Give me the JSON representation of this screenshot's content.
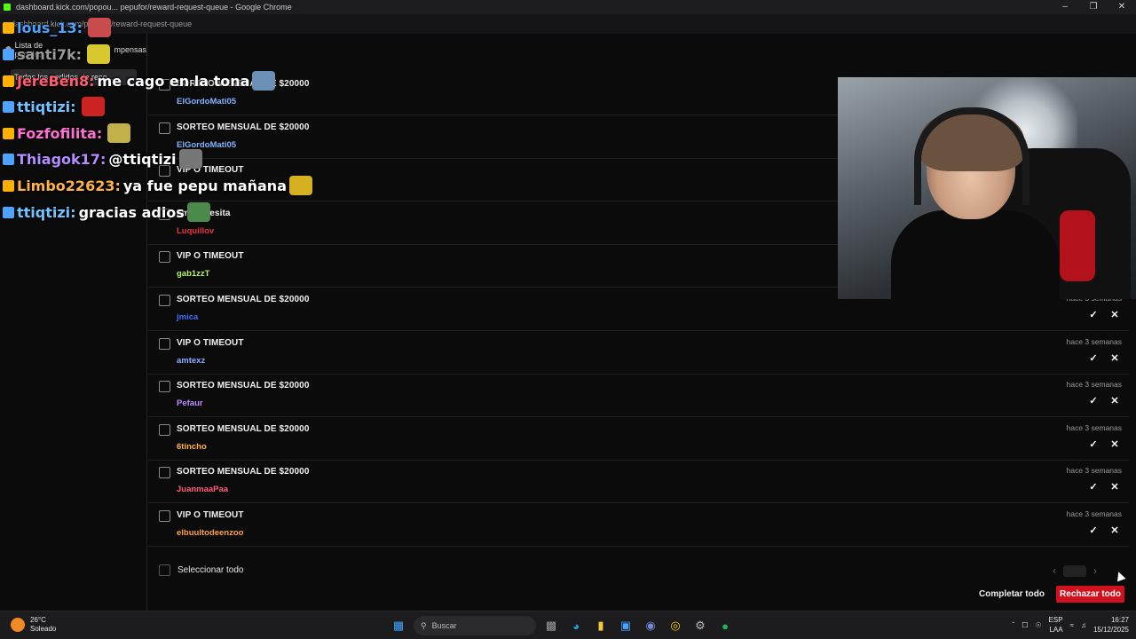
{
  "window": {
    "title": "dashboard.kick.com/popou... pepufor/reward-request-queue - Google Chrome",
    "url_text": "dashboard.kick.com/pepufor/reward-request-queue"
  },
  "sidebar": {
    "list_label": "Lista de pedidos",
    "list_suffix": "mpensas",
    "sub_label": "Todos los pedidos de reco..."
  },
  "chat": [
    {
      "user": "lous_13:",
      "user_color": "#4fa3ff",
      "msg": ""
    },
    {
      "user": "santi7k:",
      "user_color": "#9a9a9a",
      "msg": ""
    },
    {
      "user": "JereBen8:",
      "user_color": "#ff5a6e",
      "msg": "me cago en la tona"
    },
    {
      "user": "ttiqtizi:",
      "user_color": "#6fc3ff",
      "msg": ""
    },
    {
      "user": "Fozfofilita:",
      "user_color": "#ff6fd2",
      "msg": ""
    },
    {
      "user": "Thiagok17:",
      "user_color": "#b48cff",
      "msg": "@ttiqtizi"
    },
    {
      "user": "Limbo22623:",
      "user_color": "#ffb347",
      "msg": "ya fue pepu mañana"
    },
    {
      "user": "ttiqtizi:",
      "user_color": "#6fc3ff",
      "msg": "gracias adios"
    }
  ],
  "requests": [
    {
      "title": "SORTEO MENSUAL DE $20000",
      "user": "ElGordoMati05",
      "user_color": "#7fb2ff",
      "time": ""
    },
    {
      "title": "SORTEO MENSUAL DE $20000",
      "user": "ElGordoMati05",
      "user_color": "#7fb2ff",
      "time": ""
    },
    {
      "title": "VIP O TIMEOUT",
      "user": "",
      "user_color": "#c9a3ff",
      "time": ""
    },
    {
      "title": "amburgesita",
      "user": "Luquillov",
      "user_color": "#e8323f",
      "time": ""
    },
    {
      "title": "VIP O TIMEOUT",
      "user": "gab1zzT",
      "user_color": "#b7f06a",
      "time": ""
    },
    {
      "title": "SORTEO MENSUAL DE $20000",
      "user": "jmica",
      "user_color": "#3f6cff",
      "time": "hace 3 semanas"
    },
    {
      "title": "VIP O TIMEOUT",
      "user": "amtexz",
      "user_color": "#8fa9ff",
      "time": "hace 3 semanas"
    },
    {
      "title": "SORTEO MENSUAL DE $20000",
      "user": "Pefaur",
      "user_color": "#c08bff",
      "time": "hace 3 semanas"
    },
    {
      "title": "SORTEO MENSUAL DE $20000",
      "user": "6tincho",
      "user_color": "#ffb340",
      "time": "hace 3 semanas"
    },
    {
      "title": "SORTEO MENSUAL DE $20000",
      "user": "JuanmaaPaa",
      "user_color": "#ff5c7a",
      "time": "hace 3 semanas"
    },
    {
      "title": "VIP O TIMEOUT",
      "user": "elbuultodeenzoo",
      "user_color": "#ff9f40",
      "time": "hace 3 semanas"
    }
  ],
  "footer": {
    "select_all": "Seleccionar todo",
    "complete_all": "Completar todo",
    "reject_all": "Rechazar todo"
  },
  "taskbar": {
    "temp": "26°C",
    "weather": "Soleado",
    "search_placeholder": "Buscar",
    "lang_top": "ESP",
    "lang_bottom": "LAA",
    "time": "16:27",
    "date": "15/12/2025"
  },
  "colors": {
    "reject": "#d0111e",
    "kick_green": "#53fc18"
  }
}
